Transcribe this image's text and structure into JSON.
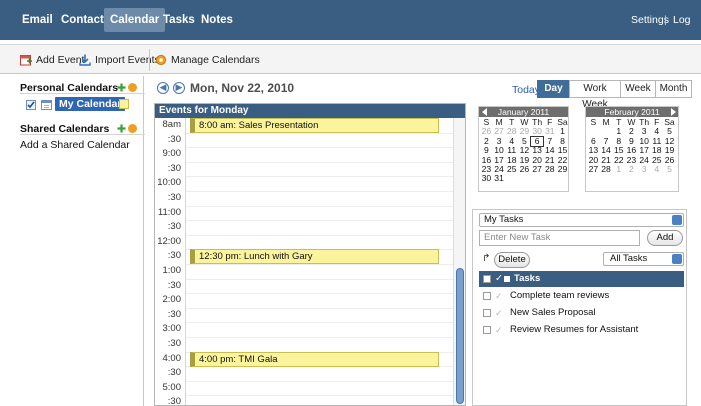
{
  "nav": {
    "tabs": [
      "Email",
      "Contacts",
      "Calendar",
      "Tasks",
      "Notes"
    ],
    "active_tab": "Calendar",
    "right_links": [
      "Settings",
      "Log Out"
    ],
    "separator": "|"
  },
  "toolbar": {
    "add_event": "Add Event",
    "import_events": "Import Events",
    "manage_calendars": "Manage Calendars"
  },
  "sidebar": {
    "personal_header": "Personal Calendars",
    "personal_calendar": "My Calendar",
    "shared_header": "Shared Calendars",
    "add_shared": "Add a Shared Calendar"
  },
  "header": {
    "date": "Mon, Nov 22, 2010",
    "today": "Today",
    "views": [
      "Day",
      "Work Week",
      "Week",
      "Month"
    ],
    "active_view": "Day"
  },
  "day_view": {
    "title": "Events for Monday",
    "times": [
      "8am",
      ":30",
      "9:00",
      ":30",
      "10:00",
      ":30",
      "11:00",
      ":30",
      "12:00",
      ":30",
      "1:00",
      ":30",
      "2:00",
      ":30",
      "3:00",
      ":30",
      "4:00",
      ":30",
      "5:00",
      ":30"
    ],
    "events": [
      {
        "label": "8:00 am: Sales Presentation"
      },
      {
        "label": "12:30 pm: Lunch with Gary"
      },
      {
        "label": "4:00 pm: TMI Gala"
      }
    ]
  },
  "mini_calendars": [
    {
      "title": "January 2011",
      "weekdays": [
        "S",
        "M",
        "T",
        "W",
        "Th",
        "F",
        "Sa"
      ],
      "weeks": [
        [
          "26",
          "27",
          "28",
          "29",
          "30",
          "31",
          "1"
        ],
        [
          "2",
          "3",
          "4",
          "5",
          "6",
          "7",
          "8"
        ],
        [
          "9",
          "10",
          "11",
          "12",
          "13",
          "14",
          "15"
        ],
        [
          "16",
          "17",
          "18",
          "19",
          "20",
          "21",
          "22"
        ],
        [
          "23",
          "24",
          "25",
          "26",
          "27",
          "28",
          "29"
        ],
        [
          "30",
          "31",
          "",
          "",
          "",
          "",
          ""
        ]
      ],
      "selected": "6"
    },
    {
      "title": "February 2011",
      "weekdays": [
        "S",
        "M",
        "T",
        "W",
        "Th",
        "F",
        "Sa"
      ],
      "weeks": [
        [
          "",
          "",
          "1",
          "2",
          "3",
          "4",
          "5"
        ],
        [
          "6",
          "7",
          "8",
          "9",
          "10",
          "11",
          "12"
        ],
        [
          "13",
          "14",
          "15",
          "16",
          "17",
          "18",
          "19"
        ],
        [
          "20",
          "21",
          "22",
          "23",
          "24",
          "25",
          "26"
        ],
        [
          "27",
          "28",
          "1",
          "2",
          "3",
          "4",
          "5"
        ]
      ],
      "selected": ""
    }
  ],
  "tasks": {
    "list_select": "My Tasks",
    "new_task_placeholder": "Enter New Task",
    "add_button": "Add",
    "delete_button": "Delete",
    "filter_select": "All Tasks",
    "header": "Tasks",
    "items": [
      "Complete team reviews",
      "New Sales Proposal",
      "Review Resumes for Assistant"
    ]
  },
  "colors": {
    "nav_bar": "#3a5e82",
    "event_fill": "#fbf49c",
    "accent_blue": "#4b77ad",
    "selected_calendar": "#2f66b3"
  }
}
